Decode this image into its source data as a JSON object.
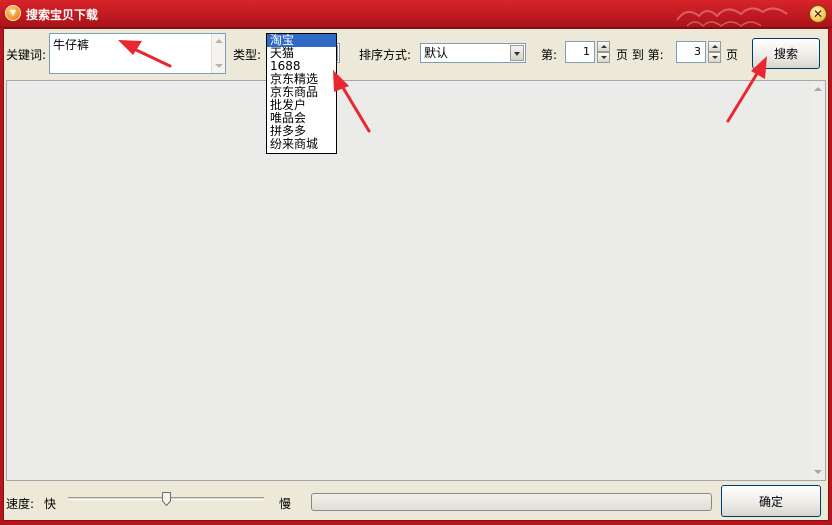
{
  "window": {
    "title": "搜索宝贝下载",
    "close_glyph": "✕"
  },
  "search": {
    "keyword_label": "关键词:",
    "keyword_value": "牛仔裤",
    "type_label": "类型:",
    "type_selected": "淘宝",
    "type_options": [
      "淘宝",
      "天猫",
      "1688",
      "京东精选",
      "京东商品",
      "批发户",
      "唯品会",
      "拼多多",
      "纷来商城"
    ],
    "sort_label": "排序方式:",
    "sort_selected": "默认",
    "page_from_label": "第:",
    "page_from_value": "1",
    "page_mid_label": "页 到 第:",
    "page_to_value": "3",
    "page_end_label": "页",
    "search_button": "搜索"
  },
  "footer": {
    "speed_label": "速度:",
    "speed_fast": "快",
    "speed_slow": "慢",
    "speed_level": 0.5,
    "progress": 0,
    "ok_button": "确定"
  },
  "colors": {
    "titlebar": "#c01a20",
    "selection": "#316ac5",
    "arrow": "#e8282e"
  }
}
